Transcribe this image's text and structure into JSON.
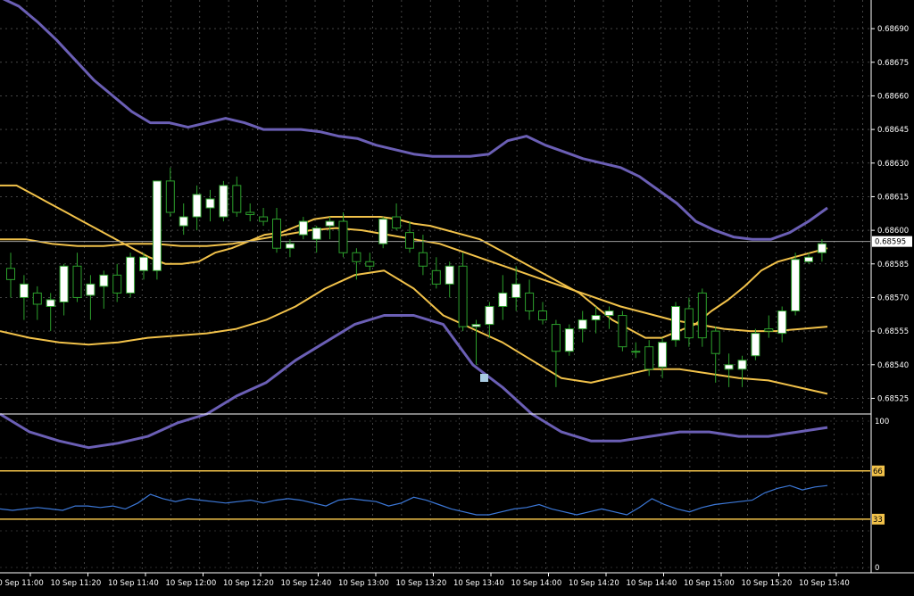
{
  "colors": {
    "background": "#000000",
    "grid": "#c8c8c8",
    "axis": "#ffffff",
    "text": "#ffffff",
    "bull_fill": "#ffffff",
    "bull_outline": "#2ca02c",
    "bear_fill": "#000000",
    "bear_outline": "#2ca02c",
    "wick": "#2ca02c",
    "outer_band": "#6b5fb5",
    "inner_band": "#f2c24a",
    "mid_band": "#f2c24a",
    "ghost_line": "#8a7a3a",
    "price_line": "#9a9a9a",
    "oscillator": "#3c78d8",
    "level_line": "#f2c24a",
    "marker": "#a9cce3"
  },
  "chart_data": [
    {
      "type": "candlestick",
      "panel": "main",
      "ylim": [
        0.6852,
        0.687
      ],
      "y_ticks": [
        "0.68690",
        "0.68675",
        "0.68660",
        "0.68645",
        "0.68630",
        "0.68615",
        "0.68600",
        "0.68585",
        "0.68570",
        "0.68555",
        "0.68540",
        "0.68525"
      ],
      "current_price": "0.68595",
      "grid": true,
      "x_labels": [
        "10 Sep 11:00",
        "10 Sep 11:20",
        "10 Sep 11:40",
        "10 Sep 12:00",
        "10 Sep 12:20",
        "10 Sep 12:40",
        "10 Sep 13:00",
        "10 Sep 13:20",
        "10 Sep 13:40",
        "10 Sep 14:00",
        "10 Sep 14:20",
        "10 Sep 14:40",
        "10 Sep 15:00",
        "10 Sep 15:20",
        "10 Sep 15:40"
      ],
      "candles": [
        {
          "o": 0.68583,
          "h": 0.6859,
          "l": 0.6857,
          "c": 0.68578
        },
        {
          "o": 0.6857,
          "h": 0.6858,
          "l": 0.6856,
          "c": 0.68576
        },
        {
          "o": 0.68572,
          "h": 0.68575,
          "l": 0.6856,
          "c": 0.68567
        },
        {
          "o": 0.68566,
          "h": 0.68572,
          "l": 0.68555,
          "c": 0.68569
        },
        {
          "o": 0.68568,
          "h": 0.68585,
          "l": 0.68562,
          "c": 0.68584
        },
        {
          "o": 0.68584,
          "h": 0.6859,
          "l": 0.68568,
          "c": 0.6857
        },
        {
          "o": 0.68571,
          "h": 0.6858,
          "l": 0.6856,
          "c": 0.68576
        },
        {
          "o": 0.68575,
          "h": 0.68582,
          "l": 0.68565,
          "c": 0.6858
        },
        {
          "o": 0.6858,
          "h": 0.68585,
          "l": 0.68568,
          "c": 0.68572
        },
        {
          "o": 0.68572,
          "h": 0.6859,
          "l": 0.6857,
          "c": 0.68588
        },
        {
          "o": 0.68582,
          "h": 0.6859,
          "l": 0.68578,
          "c": 0.68588
        },
        {
          "o": 0.68582,
          "h": 0.686,
          "l": 0.68578,
          "c": 0.68622
        },
        {
          "o": 0.68622,
          "h": 0.68628,
          "l": 0.68606,
          "c": 0.68608
        },
        {
          "o": 0.68602,
          "h": 0.68612,
          "l": 0.68598,
          "c": 0.68606
        },
        {
          "o": 0.68606,
          "h": 0.6862,
          "l": 0.686,
          "c": 0.68616
        },
        {
          "o": 0.6861,
          "h": 0.68618,
          "l": 0.68604,
          "c": 0.68614
        },
        {
          "o": 0.68606,
          "h": 0.68622,
          "l": 0.68604,
          "c": 0.6862
        },
        {
          "o": 0.6862,
          "h": 0.68624,
          "l": 0.68606,
          "c": 0.68608
        },
        {
          "o": 0.68608,
          "h": 0.68612,
          "l": 0.68604,
          "c": 0.68607
        },
        {
          "o": 0.68606,
          "h": 0.6861,
          "l": 0.68602,
          "c": 0.68604
        },
        {
          "o": 0.68605,
          "h": 0.6861,
          "l": 0.6859,
          "c": 0.68592
        },
        {
          "o": 0.68592,
          "h": 0.68596,
          "l": 0.68588,
          "c": 0.68594
        },
        {
          "o": 0.68598,
          "h": 0.68606,
          "l": 0.68596,
          "c": 0.68604
        },
        {
          "o": 0.68596,
          "h": 0.68602,
          "l": 0.6859,
          "c": 0.68601
        },
        {
          "o": 0.68602,
          "h": 0.68606,
          "l": 0.68596,
          "c": 0.68604
        },
        {
          "o": 0.68604,
          "h": 0.68608,
          "l": 0.68588,
          "c": 0.6859
        },
        {
          "o": 0.6859,
          "h": 0.68592,
          "l": 0.68578,
          "c": 0.68586
        },
        {
          "o": 0.68586,
          "h": 0.6859,
          "l": 0.68582,
          "c": 0.68584
        },
        {
          "o": 0.68594,
          "h": 0.68606,
          "l": 0.68592,
          "c": 0.68605
        },
        {
          "o": 0.68606,
          "h": 0.68612,
          "l": 0.686,
          "c": 0.68601
        },
        {
          "o": 0.68599,
          "h": 0.68604,
          "l": 0.6859,
          "c": 0.68592
        },
        {
          "o": 0.6859,
          "h": 0.68598,
          "l": 0.6858,
          "c": 0.68584
        },
        {
          "o": 0.68582,
          "h": 0.68588,
          "l": 0.68574,
          "c": 0.68576
        },
        {
          "o": 0.68576,
          "h": 0.68586,
          "l": 0.6857,
          "c": 0.68584
        },
        {
          "o": 0.68584,
          "h": 0.6859,
          "l": 0.68555,
          "c": 0.68557
        },
        {
          "o": 0.68557,
          "h": 0.6856,
          "l": 0.6854,
          "c": 0.68558
        },
        {
          "o": 0.68558,
          "h": 0.68568,
          "l": 0.68552,
          "c": 0.68566
        },
        {
          "o": 0.68566,
          "h": 0.6858,
          "l": 0.6856,
          "c": 0.68572
        },
        {
          "o": 0.6857,
          "h": 0.68584,
          "l": 0.68564,
          "c": 0.68576
        },
        {
          "o": 0.68572,
          "h": 0.68578,
          "l": 0.6856,
          "c": 0.68564
        },
        {
          "o": 0.68564,
          "h": 0.68568,
          "l": 0.68558,
          "c": 0.6856
        },
        {
          "o": 0.68558,
          "h": 0.6856,
          "l": 0.6853,
          "c": 0.68546
        },
        {
          "o": 0.68546,
          "h": 0.68558,
          "l": 0.68544,
          "c": 0.68556
        },
        {
          "o": 0.68556,
          "h": 0.68564,
          "l": 0.6855,
          "c": 0.6856
        },
        {
          "o": 0.6856,
          "h": 0.68566,
          "l": 0.68554,
          "c": 0.68562
        },
        {
          "o": 0.68562,
          "h": 0.68566,
          "l": 0.68556,
          "c": 0.68564
        },
        {
          "o": 0.68562,
          "h": 0.68564,
          "l": 0.68546,
          "c": 0.68548
        },
        {
          "o": 0.68546,
          "h": 0.6855,
          "l": 0.68543,
          "c": 0.68546
        },
        {
          "o": 0.68548,
          "h": 0.68551,
          "l": 0.68535,
          "c": 0.68538
        },
        {
          "o": 0.68539,
          "h": 0.68552,
          "l": 0.68534,
          "c": 0.6855
        },
        {
          "o": 0.68551,
          "h": 0.68568,
          "l": 0.68548,
          "c": 0.68566
        },
        {
          "o": 0.68565,
          "h": 0.6857,
          "l": 0.68548,
          "c": 0.68552
        },
        {
          "o": 0.68572,
          "h": 0.68574,
          "l": 0.68548,
          "c": 0.68552
        },
        {
          "o": 0.68555,
          "h": 0.68557,
          "l": 0.68532,
          "c": 0.68545
        },
        {
          "o": 0.68538,
          "h": 0.68545,
          "l": 0.6853,
          "c": 0.6854
        },
        {
          "o": 0.68538,
          "h": 0.68544,
          "l": 0.6853,
          "c": 0.68542
        },
        {
          "o": 0.68544,
          "h": 0.68556,
          "l": 0.68542,
          "c": 0.68554
        },
        {
          "o": 0.68556,
          "h": 0.68562,
          "l": 0.68552,
          "c": 0.68555
        },
        {
          "o": 0.68554,
          "h": 0.68566,
          "l": 0.6855,
          "c": 0.68564
        },
        {
          "o": 0.68564,
          "h": 0.6859,
          "l": 0.68562,
          "c": 0.68587
        },
        {
          "o": 0.68586,
          "h": 0.6859,
          "l": 0.68585,
          "c": 0.68588
        },
        {
          "o": 0.6859,
          "h": 0.68596,
          "l": 0.68586,
          "c": 0.68594
        }
      ],
      "overlays": {
        "outer_upper": [
          0.68704,
          0.687,
          0.68693,
          0.68685,
          0.68676,
          0.68667,
          0.6866,
          0.68653,
          0.68648,
          0.68648,
          0.68646,
          0.68648,
          0.6865,
          0.68648,
          0.68645,
          0.68645,
          0.68645,
          0.68644,
          0.68642,
          0.68641,
          0.68638,
          0.68636,
          0.68634,
          0.68633,
          0.68633,
          0.68633,
          0.68634,
          0.6864,
          0.68642,
          0.68638,
          0.68635,
          0.68632,
          0.6863,
          0.68628,
          0.68624,
          0.68618,
          0.68612,
          0.68604,
          0.686,
          0.68597,
          0.68596,
          0.68596,
          0.68599,
          0.68604,
          0.6861
        ],
        "inner_upper": [
          0.6862,
          0.6862,
          0.68616,
          0.68612,
          0.68608,
          0.68604,
          0.686,
          0.68596,
          0.68592,
          0.68588,
          0.68585,
          0.68585,
          0.68586,
          0.6859,
          0.68592,
          0.68595,
          0.68598,
          0.68599,
          0.68602,
          0.68605,
          0.68606,
          0.68606,
          0.68606,
          0.68606,
          0.68605,
          0.68603,
          0.68602,
          0.686,
          0.68598,
          0.68596,
          0.68592,
          0.68588,
          0.68584,
          0.6858,
          0.68576,
          0.68572,
          0.68566,
          0.6856,
          0.68556,
          0.68552,
          0.68552,
          0.68555,
          0.68558,
          0.68564,
          0.68569,
          0.68575,
          0.68582,
          0.68586,
          0.68588,
          0.6859,
          0.68592
        ],
        "middle": [
          0.68596,
          0.68596,
          0.68594,
          0.68593,
          0.68593,
          0.68594,
          0.68594,
          0.68593,
          0.68593,
          0.68594,
          0.68596,
          0.68598,
          0.686,
          0.68601,
          0.686,
          0.68598,
          0.68596,
          0.68594,
          0.6859,
          0.68586,
          0.68582,
          0.68578,
          0.68574,
          0.6857,
          0.68566,
          0.68563,
          0.6856,
          0.68558,
          0.68556,
          0.68555,
          0.68555,
          0.68556,
          0.68557
        ],
        "inner_lower": [
          0.68555,
          0.68552,
          0.6855,
          0.68549,
          0.6855,
          0.68552,
          0.68553,
          0.68554,
          0.68556,
          0.6856,
          0.68566,
          0.68574,
          0.6858,
          0.68582,
          0.68574,
          0.68562,
          0.68556,
          0.6855,
          0.68542,
          0.68534,
          0.68532,
          0.68535,
          0.68538,
          0.68538,
          0.68536,
          0.68534,
          0.68533,
          0.6853,
          0.68527
        ],
        "outer_lower": [
          0.68518,
          0.6851,
          0.68506,
          0.68503,
          0.68505,
          0.68508,
          0.68514,
          0.68518,
          0.68526,
          0.68532,
          0.68542,
          0.6855,
          0.68558,
          0.68562,
          0.68562,
          0.68558,
          0.6854,
          0.6853,
          0.68518,
          0.6851,
          0.68506,
          0.68506,
          0.68508,
          0.6851,
          0.6851,
          0.68508,
          0.68508,
          0.6851,
          0.68512
        ]
      }
    },
    {
      "type": "line",
      "panel": "oscillator",
      "ylim": [
        0,
        100
      ],
      "y_ticks": [
        "100",
        "0"
      ],
      "levels": [
        "66",
        "33"
      ],
      "level_values": [
        66,
        33
      ],
      "series": [
        {
          "values": [
            40,
            39,
            40,
            41,
            40,
            39,
            42,
            42,
            41,
            42,
            40,
            44,
            50,
            47,
            45,
            47,
            46,
            45,
            44,
            45,
            46,
            44,
            46,
            47,
            46,
            44,
            42,
            46,
            47,
            46,
            45,
            42,
            44,
            48,
            46,
            43,
            40,
            38,
            36,
            36,
            38,
            40,
            41,
            43,
            40,
            38,
            36,
            38,
            40,
            38,
            36,
            41,
            47,
            43,
            40,
            38,
            41,
            43,
            44,
            45,
            46,
            51,
            54,
            56,
            53,
            55,
            56
          ]
        }
      ]
    }
  ]
}
